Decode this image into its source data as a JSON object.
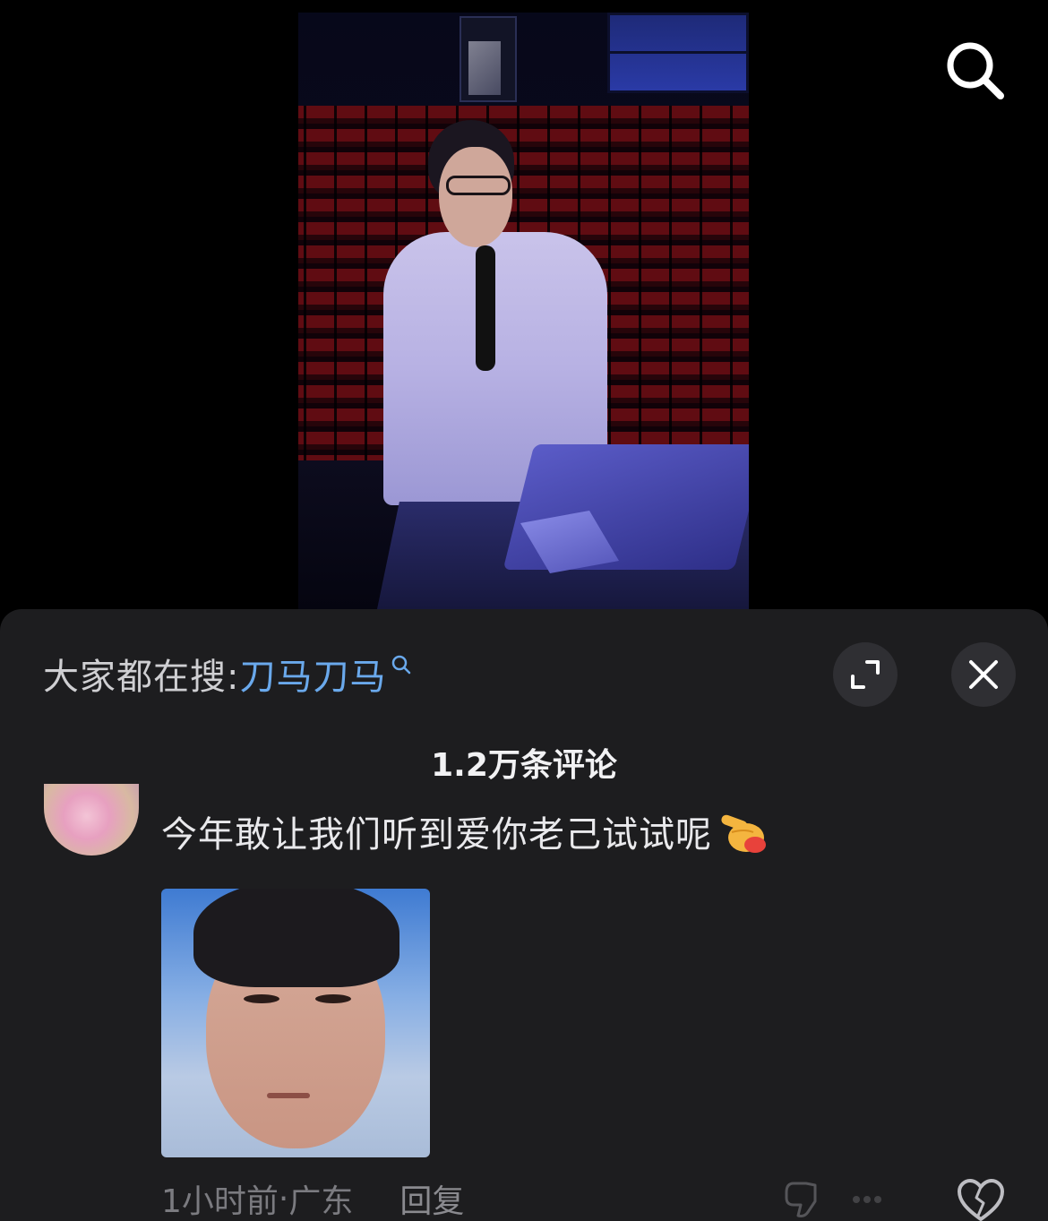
{
  "hot_search": {
    "prefix": "大家都在搜:",
    "term": "刀马刀马"
  },
  "comments": {
    "count_label": "1.2万条评论"
  },
  "comment": {
    "text": "今年敢让我们听到爱你老己试试呢",
    "time": "1小时前",
    "separator": " · ",
    "location": "广东",
    "reply_label": "回复"
  },
  "icons": {
    "search": "search-icon",
    "expand": "expand-icon",
    "close": "close-icon",
    "emoji": "pointing-hand-emoji",
    "dislike": "dislike-icon",
    "like": "heart-icon"
  },
  "colors": {
    "panel_bg": "#1d1d1f",
    "hot_term": "#6aa9ec",
    "meta_text": "#7b7b80"
  }
}
